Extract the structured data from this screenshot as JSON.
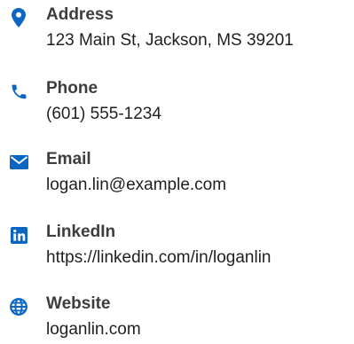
{
  "accent_color": "#0a66c2",
  "contacts": [
    {
      "icon": "map-pin-icon",
      "label": "Address",
      "value": "123 Main St, Jackson, MS 39201"
    },
    {
      "icon": "phone-icon",
      "label": "Phone",
      "value": "(601) 555-1234"
    },
    {
      "icon": "envelope-icon",
      "label": "Email",
      "value": "logan.lin@example.com"
    },
    {
      "icon": "linkedin-icon",
      "label": "LinkedIn",
      "value": "https://linkedin.com/in/loganlin"
    },
    {
      "icon": "globe-icon",
      "label": "Website",
      "value": "loganlin.com"
    }
  ]
}
